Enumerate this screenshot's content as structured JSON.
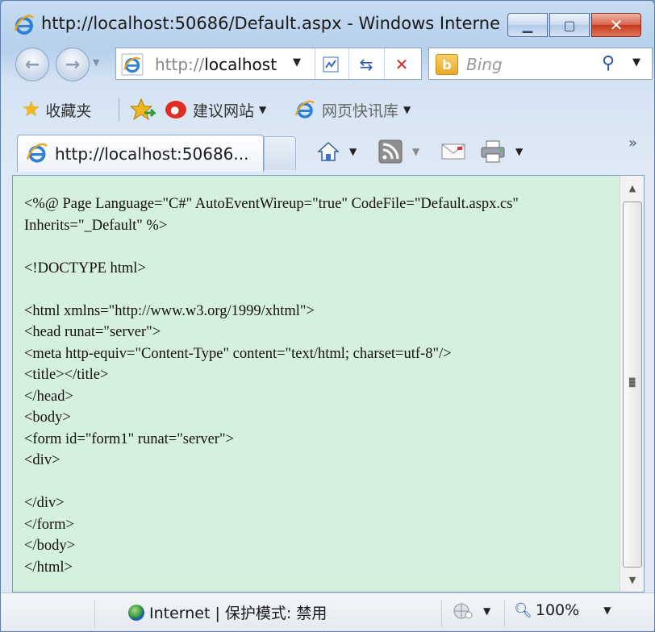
{
  "window": {
    "title": "http://localhost:50686/Default.aspx - Windows Interne..."
  },
  "nav": {
    "address_prefix": "http://",
    "address_host": "localhost",
    "search_placeholder": "Bing"
  },
  "favorites": {
    "favorites_label": "收藏夹",
    "suggested_sites_label": "建议网站",
    "web_slice_label": "网页快讯库"
  },
  "tabs": [
    {
      "label": "http://localhost:50686..."
    }
  ],
  "content": {
    "code_lines": [
      "<%@ Page Language=\"C#\" AutoEventWireup=\"true\" CodeFile=\"Default.aspx.cs\"",
      "Inherits=\"_Default\" %>",
      "",
      "<!DOCTYPE html>",
      "",
      "<html xmlns=\"http://www.w3.org/1999/xhtml\">",
      "<head runat=\"server\">",
      "<meta http-equiv=\"Content-Type\" content=\"text/html; charset=utf-8\"/>",
      "<title></title>",
      "</head>",
      "<body>",
      "<form id=\"form1\" runat=\"server\">",
      "<div>",
      "",
      "</div>",
      "</form>",
      "</body>",
      "</html>"
    ]
  },
  "status": {
    "zone_text": "Internet | 保护模式: 禁用",
    "zoom_text": "100%"
  },
  "icons": {
    "browser": "ie-logo-icon",
    "search_provider": "bing-icon",
    "home": "home-icon",
    "feeds": "rss-icon",
    "mail": "mail-icon",
    "print": "printer-icon"
  }
}
